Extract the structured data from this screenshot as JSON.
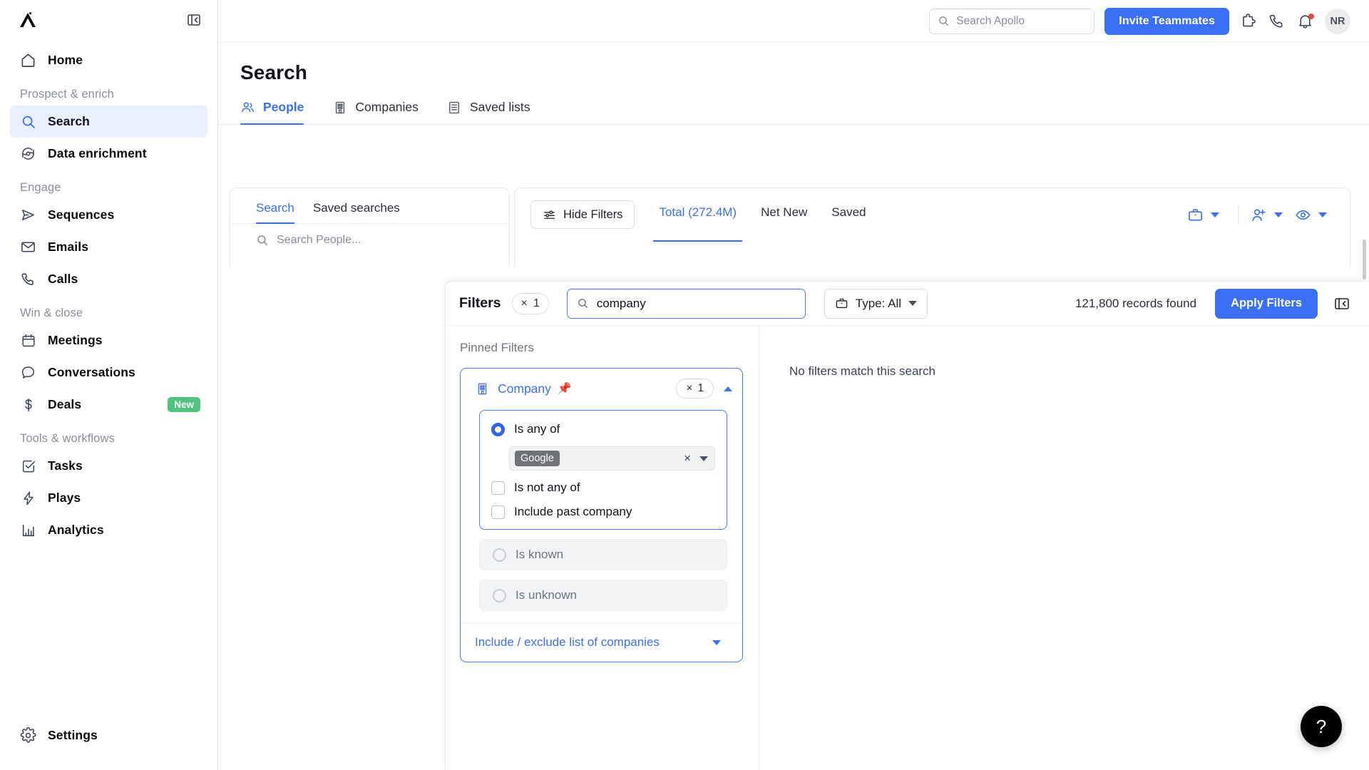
{
  "sidebar": {
    "logo_name": "apollo-logo",
    "collapse_label": "collapse-sidebar",
    "home": {
      "label": "Home",
      "icon": "home-icon"
    },
    "sections": [
      {
        "title": "Prospect & enrich",
        "items": [
          {
            "label": "Search",
            "icon": "search-icon",
            "active": true
          },
          {
            "label": "Data enrichment",
            "icon": "refresh-data-icon",
            "active": false
          }
        ]
      },
      {
        "title": "Engage",
        "items": [
          {
            "label": "Sequences",
            "icon": "send-icon",
            "active": false
          },
          {
            "label": "Emails",
            "icon": "mail-icon",
            "active": false
          },
          {
            "label": "Calls",
            "icon": "phone-icon",
            "active": false
          }
        ]
      },
      {
        "title": "Win & close",
        "items": [
          {
            "label": "Meetings",
            "icon": "calendar-icon",
            "active": false
          },
          {
            "label": "Conversations",
            "icon": "chat-bubble-icon",
            "active": false
          },
          {
            "label": "Deals",
            "icon": "dollar-icon",
            "active": false,
            "badge": "New"
          }
        ]
      },
      {
        "title": "Tools & workflows",
        "items": [
          {
            "label": "Tasks",
            "icon": "check-square-icon",
            "active": false
          },
          {
            "label": "Plays",
            "icon": "lightning-icon",
            "active": false
          },
          {
            "label": "Analytics",
            "icon": "bar-chart-icon",
            "active": false
          }
        ]
      }
    ],
    "settings": {
      "label": "Settings",
      "icon": "gear-icon"
    }
  },
  "topbar": {
    "search_placeholder": "Search Apollo",
    "invite_label": "Invite Teammates",
    "icons": [
      "puzzle-icon",
      "phone-icon",
      "bell-icon"
    ],
    "avatar_initials": "NR"
  },
  "page": {
    "title": "Search",
    "tabs": [
      {
        "label": "People",
        "icon": "people-icon",
        "active": true
      },
      {
        "label": "Companies",
        "icon": "building-icon",
        "active": false
      },
      {
        "label": "Saved lists",
        "icon": "list-icon",
        "active": false
      }
    ]
  },
  "search_panel": {
    "tabs": [
      {
        "label": "Search",
        "active": true
      },
      {
        "label": "Saved searches",
        "active": false
      }
    ],
    "input_placeholder": "Search People..."
  },
  "results_toolbar": {
    "hide_filters_label": "Hide Filters",
    "tabs": [
      {
        "label": "Total (272.4M)",
        "active": true
      },
      {
        "label": "Net New",
        "active": false
      },
      {
        "label": "Saved",
        "active": false
      }
    ],
    "actions": [
      {
        "icon": "briefcase-icon",
        "caret": true
      },
      {
        "icon": "add-person-icon",
        "caret": true
      },
      {
        "icon": "eye-icon",
        "caret": true
      }
    ]
  },
  "filters_panel": {
    "title": "Filters",
    "active_count": "1",
    "clear_symbol": "×",
    "search_value": "company",
    "type_label": "Type: All",
    "records_found": "121,800 records found",
    "apply_label": "Apply Filters",
    "collapse_label": "collapse-filters",
    "pinned_label": "Pinned Filters",
    "no_match_text": "No filters match this search",
    "company_filter": {
      "name": "Company",
      "pin_icon": "📌",
      "count": "1",
      "clear_symbol": "×",
      "options": {
        "is_any_of": "Is any of",
        "is_not_any_of": "Is not any of",
        "include_past_company": "Include past company",
        "is_known": "Is known",
        "is_unknown": "Is unknown"
      },
      "selected_token": "Google",
      "token_remove": "×",
      "footer_label": "Include / exclude list of companies"
    }
  },
  "help": {
    "label": "?"
  },
  "colors": {
    "accent": "#3b6ff5",
    "badge_green": "#4fc37f",
    "notification_red": "#e8453c",
    "sidebar_active_bg": "#e8efff"
  }
}
